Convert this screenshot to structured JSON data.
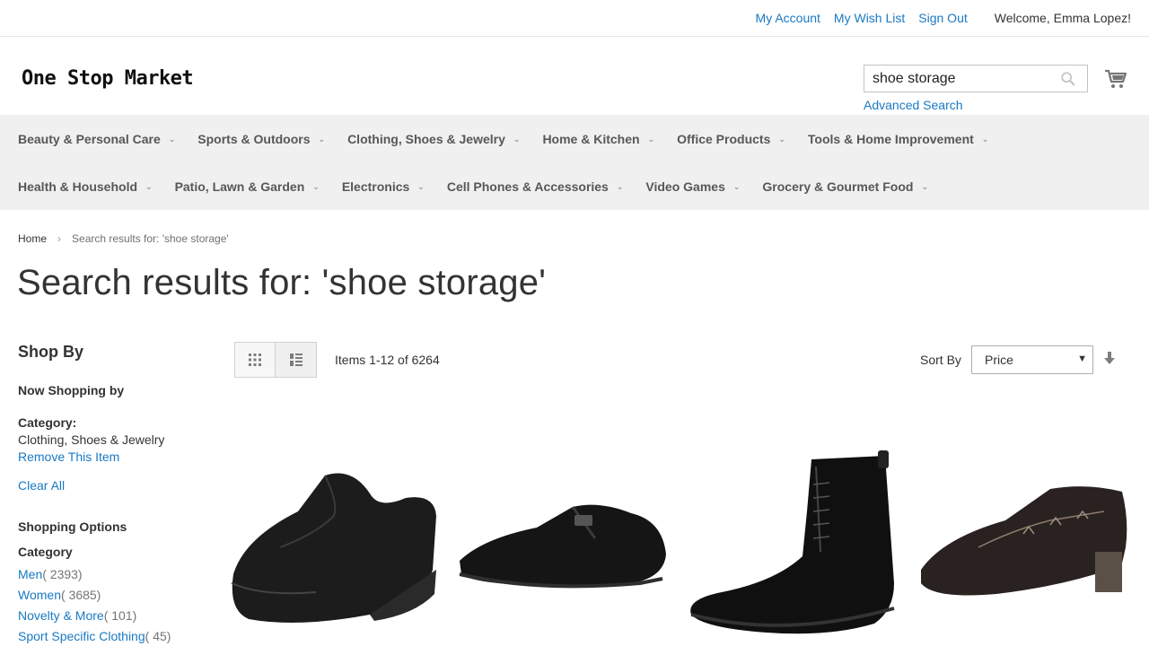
{
  "header_links": {
    "my_account": "My Account",
    "wish_list": "My Wish List",
    "sign_out": "Sign Out",
    "welcome": "Welcome, Emma Lopez!"
  },
  "logo": "One Stop Market",
  "search": {
    "value": "shoe storage",
    "advanced": "Advanced Search"
  },
  "nav": {
    "row1": [
      "Beauty & Personal Care",
      "Sports & Outdoors",
      "Clothing, Shoes & Jewelry",
      "Home & Kitchen",
      "Office Products",
      "Tools & Home Improvement"
    ],
    "row2": [
      "Health & Household",
      "Patio, Lawn & Garden",
      "Electronics",
      "Cell Phones & Accessories",
      "Video Games",
      "Grocery & Gourmet Food"
    ]
  },
  "breadcrumb": {
    "home": "Home",
    "current": "Search results for: 'shoe storage'"
  },
  "page_title": "Search results for: 'shoe storage'",
  "sidebar": {
    "shop_by": "Shop By",
    "now_shopping": "Now Shopping by",
    "filter_label": "Category:",
    "filter_value": "Clothing, Shoes & Jewelry",
    "remove_item": "Remove This Item",
    "clear_all": "Clear All",
    "shopping_options": "Shopping Options",
    "category_title": "Category",
    "categories": [
      {
        "name": "Men",
        "count": "( 2393)"
      },
      {
        "name": "Women",
        "count": "( 3685)"
      },
      {
        "name": "Novelty & More",
        "count": "( 101)"
      },
      {
        "name": "Sport Specific Clothing",
        "count": "( 45)"
      }
    ]
  },
  "toolbar": {
    "items": "Items 1-12 of 6264",
    "sort_label": "Sort By",
    "sort_value": "Price"
  },
  "colors": {
    "link": "#1979c3",
    "nav_bg": "#f0f0f0",
    "text": "#333333"
  }
}
